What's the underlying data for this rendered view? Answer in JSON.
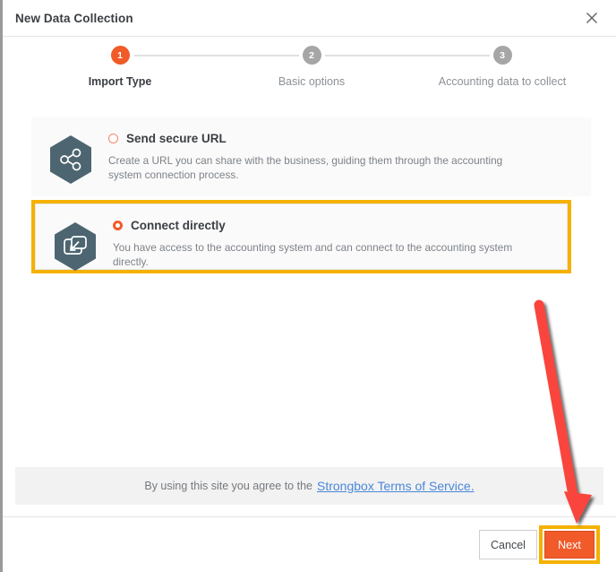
{
  "dialog": {
    "title": "New Data Collection",
    "close_icon": "close-icon"
  },
  "stepper": {
    "steps": [
      {
        "number": "1",
        "label": "Import Type",
        "state": "active"
      },
      {
        "number": "2",
        "label": "Basic options",
        "state": "inactive"
      },
      {
        "number": "3",
        "label": "Accounting data to collect",
        "state": "inactive"
      }
    ]
  },
  "options": [
    {
      "id": "send-secure-url",
      "icon": "share-icon",
      "title": "Send secure URL",
      "description": "Create a URL you can share with the business, guiding them through the accounting system connection process.",
      "selected": false
    },
    {
      "id": "connect-directly",
      "icon": "connect-import-icon",
      "title": "Connect directly",
      "description": "You have access to the accounting system and can connect to the accounting system directly.",
      "selected": true
    }
  ],
  "terms": {
    "prefix": "By using this site you agree to the",
    "link_text": "Strongbox Terms of Service."
  },
  "footer": {
    "cancel_label": "Cancel",
    "next_label": "Next"
  },
  "colors": {
    "accent_orange": "#f15a29",
    "highlight_yellow": "#f5b100",
    "annotation_red": "#f9453c",
    "icon_slate": "#4d6571",
    "link_blue": "#4a87d8",
    "inactive_gray": "#a6a6a6"
  },
  "annotations": {
    "arrow": "red-arrow-pointing-to-next-button"
  }
}
